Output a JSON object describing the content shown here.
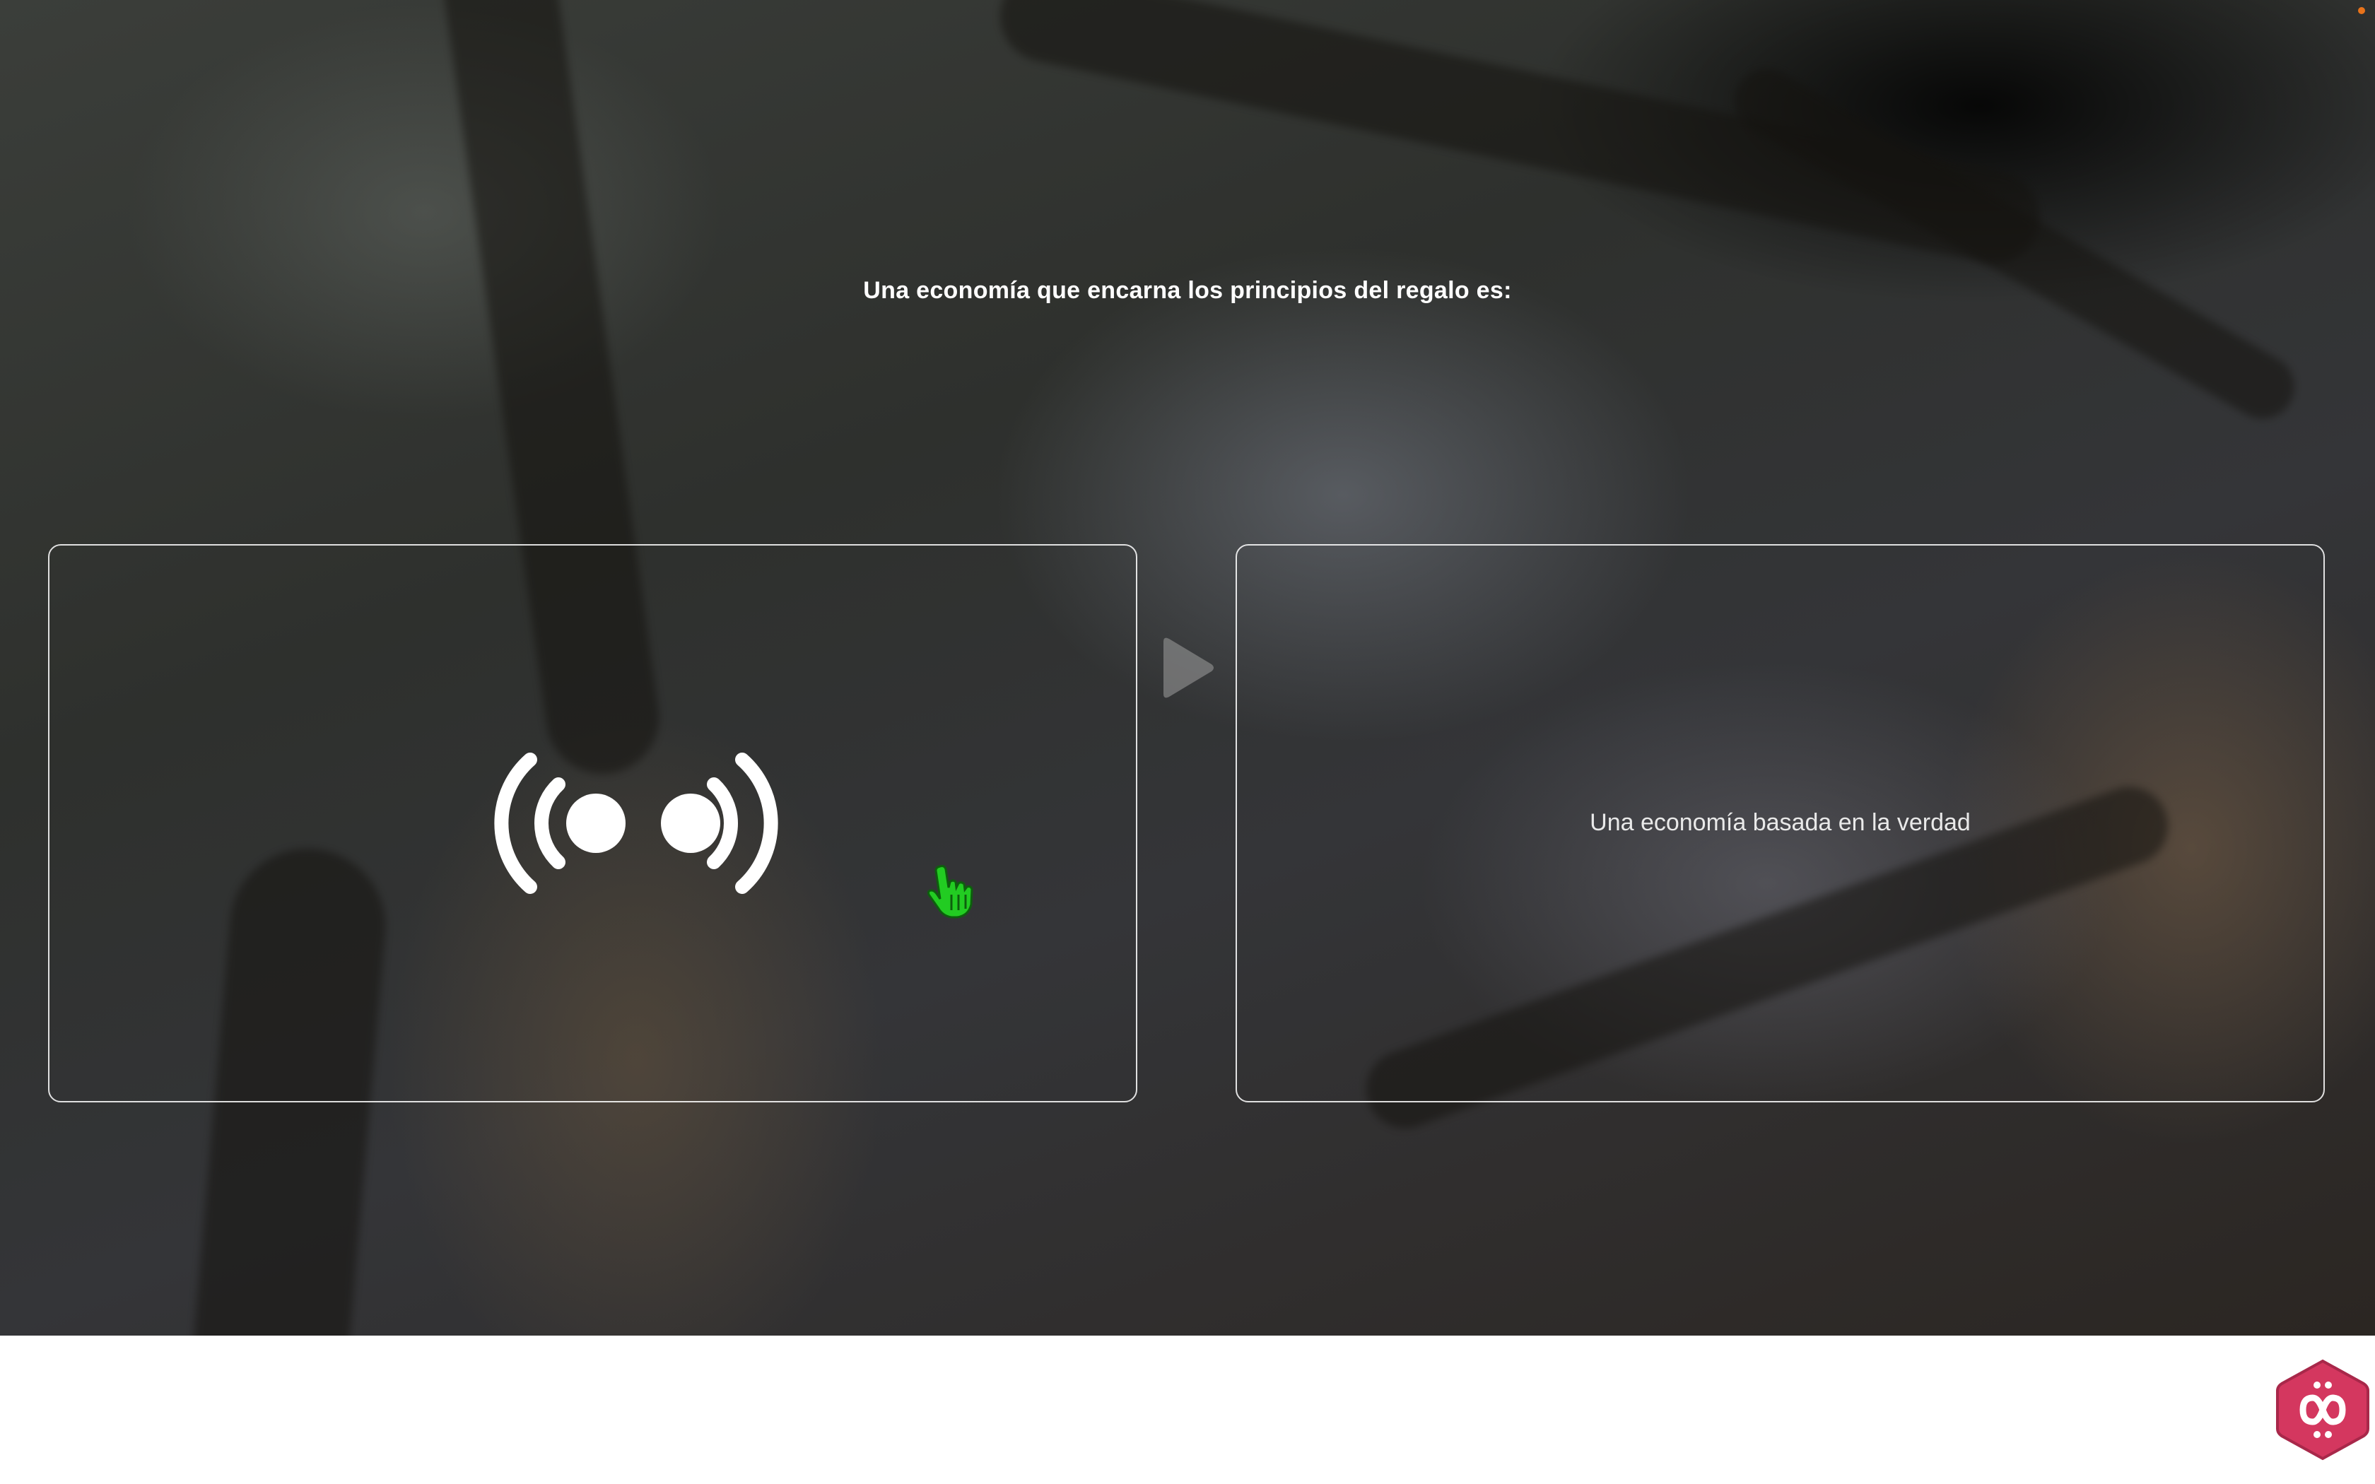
{
  "question": {
    "text": "Una economía que encarna los principios del regalo es:"
  },
  "options": [
    {
      "label": "",
      "icon": "broadcast-audio-icon"
    },
    {
      "label": "Una economía basada en la verdad"
    }
  ],
  "controls": {
    "next_icon": "play-arrow-icon"
  },
  "cursor": {
    "icon": "hand-pointer-icon",
    "color": "#22cc22"
  },
  "brand": {
    "logo_icon": "infinity-hexagon-logo",
    "color": "#d4375f"
  },
  "status": {
    "indicator_color": "#e8731a"
  }
}
